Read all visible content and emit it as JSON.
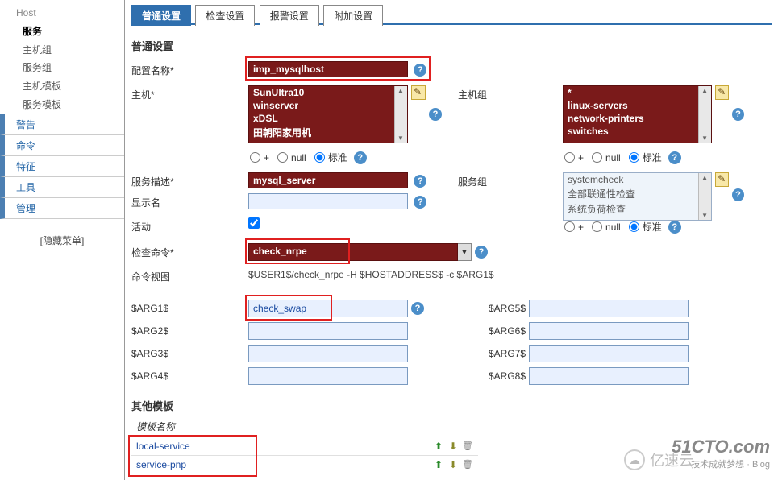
{
  "sidebar": {
    "host": "Host",
    "items": [
      "服务",
      "主机组",
      "服务组",
      "主机模板",
      "服务模板"
    ],
    "activeIndex": 0,
    "categories": [
      "警告",
      "命令",
      "特征",
      "工具",
      "管理"
    ],
    "hideMenu": "[隐藏菜单]"
  },
  "tabs": [
    "普通设置",
    "检查设置",
    "报警设置",
    "附加设置"
  ],
  "activeTab": 0,
  "section1": "普通设置",
  "labels": {
    "configName": "配置名称",
    "host": "主机",
    "hostgroup": "主机组",
    "serviceDesc": "服务描述",
    "serviceGroup": "服务组",
    "displayName": "显示名",
    "active": "活动",
    "checkCmd": "检查命令",
    "cmdView": "命令视图",
    "plus": "+",
    "null": "null",
    "standard": "标准"
  },
  "values": {
    "configName": "imp_mysqlhost",
    "hosts": [
      "SunUltra10",
      "winserver",
      "xDSL",
      "田朝阳家用机"
    ],
    "hostgroups": [
      "*",
      "linux-servers",
      "network-printers",
      "switches"
    ],
    "serviceDesc": "mysql_server",
    "serviceGroups": [
      "systemcheck",
      "全部联通性检查",
      "系统负荷检查"
    ],
    "displayName": "",
    "activeChecked": true,
    "checkCmd": "check_nrpe",
    "cmdView": "$USER1$/check_nrpe -H $HOSTADDRESS$ -c $ARG1$"
  },
  "args": {
    "left": [
      "$ARG1$",
      "$ARG2$",
      "$ARG3$",
      "$ARG4$"
    ],
    "right": [
      "$ARG5$",
      "$ARG6$",
      "$ARG7$",
      "$ARG8$"
    ],
    "values": {
      "arg1": "check_swap"
    }
  },
  "templates": {
    "header": "其他模板",
    "colHead": "模板名称",
    "rows": [
      "local-service",
      "service-pnp"
    ]
  },
  "watermark": {
    "site": "51CTO.com",
    "sub1": "技术成就梦想",
    "sub2": "Blog",
    "brand": "亿速云"
  }
}
